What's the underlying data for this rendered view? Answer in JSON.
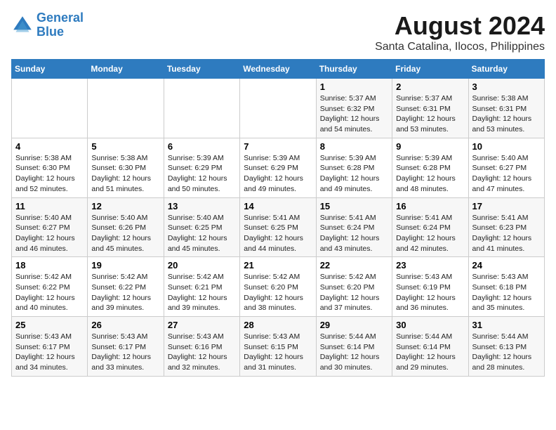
{
  "header": {
    "logo_line1": "General",
    "logo_line2": "Blue",
    "main_title": "August 2024",
    "subtitle": "Santa Catalina, Ilocos, Philippines"
  },
  "days_of_week": [
    "Sunday",
    "Monday",
    "Tuesday",
    "Wednesday",
    "Thursday",
    "Friday",
    "Saturday"
  ],
  "weeks": [
    [
      {
        "day": "",
        "info": ""
      },
      {
        "day": "",
        "info": ""
      },
      {
        "day": "",
        "info": ""
      },
      {
        "day": "",
        "info": ""
      },
      {
        "day": "1",
        "info": "Sunrise: 5:37 AM\nSunset: 6:32 PM\nDaylight: 12 hours\nand 54 minutes."
      },
      {
        "day": "2",
        "info": "Sunrise: 5:37 AM\nSunset: 6:31 PM\nDaylight: 12 hours\nand 53 minutes."
      },
      {
        "day": "3",
        "info": "Sunrise: 5:38 AM\nSunset: 6:31 PM\nDaylight: 12 hours\nand 53 minutes."
      }
    ],
    [
      {
        "day": "4",
        "info": "Sunrise: 5:38 AM\nSunset: 6:30 PM\nDaylight: 12 hours\nand 52 minutes."
      },
      {
        "day": "5",
        "info": "Sunrise: 5:38 AM\nSunset: 6:30 PM\nDaylight: 12 hours\nand 51 minutes."
      },
      {
        "day": "6",
        "info": "Sunrise: 5:39 AM\nSunset: 6:29 PM\nDaylight: 12 hours\nand 50 minutes."
      },
      {
        "day": "7",
        "info": "Sunrise: 5:39 AM\nSunset: 6:29 PM\nDaylight: 12 hours\nand 49 minutes."
      },
      {
        "day": "8",
        "info": "Sunrise: 5:39 AM\nSunset: 6:28 PM\nDaylight: 12 hours\nand 49 minutes."
      },
      {
        "day": "9",
        "info": "Sunrise: 5:39 AM\nSunset: 6:28 PM\nDaylight: 12 hours\nand 48 minutes."
      },
      {
        "day": "10",
        "info": "Sunrise: 5:40 AM\nSunset: 6:27 PM\nDaylight: 12 hours\nand 47 minutes."
      }
    ],
    [
      {
        "day": "11",
        "info": "Sunrise: 5:40 AM\nSunset: 6:27 PM\nDaylight: 12 hours\nand 46 minutes."
      },
      {
        "day": "12",
        "info": "Sunrise: 5:40 AM\nSunset: 6:26 PM\nDaylight: 12 hours\nand 45 minutes."
      },
      {
        "day": "13",
        "info": "Sunrise: 5:40 AM\nSunset: 6:25 PM\nDaylight: 12 hours\nand 45 minutes."
      },
      {
        "day": "14",
        "info": "Sunrise: 5:41 AM\nSunset: 6:25 PM\nDaylight: 12 hours\nand 44 minutes."
      },
      {
        "day": "15",
        "info": "Sunrise: 5:41 AM\nSunset: 6:24 PM\nDaylight: 12 hours\nand 43 minutes."
      },
      {
        "day": "16",
        "info": "Sunrise: 5:41 AM\nSunset: 6:24 PM\nDaylight: 12 hours\nand 42 minutes."
      },
      {
        "day": "17",
        "info": "Sunrise: 5:41 AM\nSunset: 6:23 PM\nDaylight: 12 hours\nand 41 minutes."
      }
    ],
    [
      {
        "day": "18",
        "info": "Sunrise: 5:42 AM\nSunset: 6:22 PM\nDaylight: 12 hours\nand 40 minutes."
      },
      {
        "day": "19",
        "info": "Sunrise: 5:42 AM\nSunset: 6:22 PM\nDaylight: 12 hours\nand 39 minutes."
      },
      {
        "day": "20",
        "info": "Sunrise: 5:42 AM\nSunset: 6:21 PM\nDaylight: 12 hours\nand 39 minutes."
      },
      {
        "day": "21",
        "info": "Sunrise: 5:42 AM\nSunset: 6:20 PM\nDaylight: 12 hours\nand 38 minutes."
      },
      {
        "day": "22",
        "info": "Sunrise: 5:42 AM\nSunset: 6:20 PM\nDaylight: 12 hours\nand 37 minutes."
      },
      {
        "day": "23",
        "info": "Sunrise: 5:43 AM\nSunset: 6:19 PM\nDaylight: 12 hours\nand 36 minutes."
      },
      {
        "day": "24",
        "info": "Sunrise: 5:43 AM\nSunset: 6:18 PM\nDaylight: 12 hours\nand 35 minutes."
      }
    ],
    [
      {
        "day": "25",
        "info": "Sunrise: 5:43 AM\nSunset: 6:17 PM\nDaylight: 12 hours\nand 34 minutes."
      },
      {
        "day": "26",
        "info": "Sunrise: 5:43 AM\nSunset: 6:17 PM\nDaylight: 12 hours\nand 33 minutes."
      },
      {
        "day": "27",
        "info": "Sunrise: 5:43 AM\nSunset: 6:16 PM\nDaylight: 12 hours\nand 32 minutes."
      },
      {
        "day": "28",
        "info": "Sunrise: 5:43 AM\nSunset: 6:15 PM\nDaylight: 12 hours\nand 31 minutes."
      },
      {
        "day": "29",
        "info": "Sunrise: 5:44 AM\nSunset: 6:14 PM\nDaylight: 12 hours\nand 30 minutes."
      },
      {
        "day": "30",
        "info": "Sunrise: 5:44 AM\nSunset: 6:14 PM\nDaylight: 12 hours\nand 29 minutes."
      },
      {
        "day": "31",
        "info": "Sunrise: 5:44 AM\nSunset: 6:13 PM\nDaylight: 12 hours\nand 28 minutes."
      }
    ]
  ]
}
